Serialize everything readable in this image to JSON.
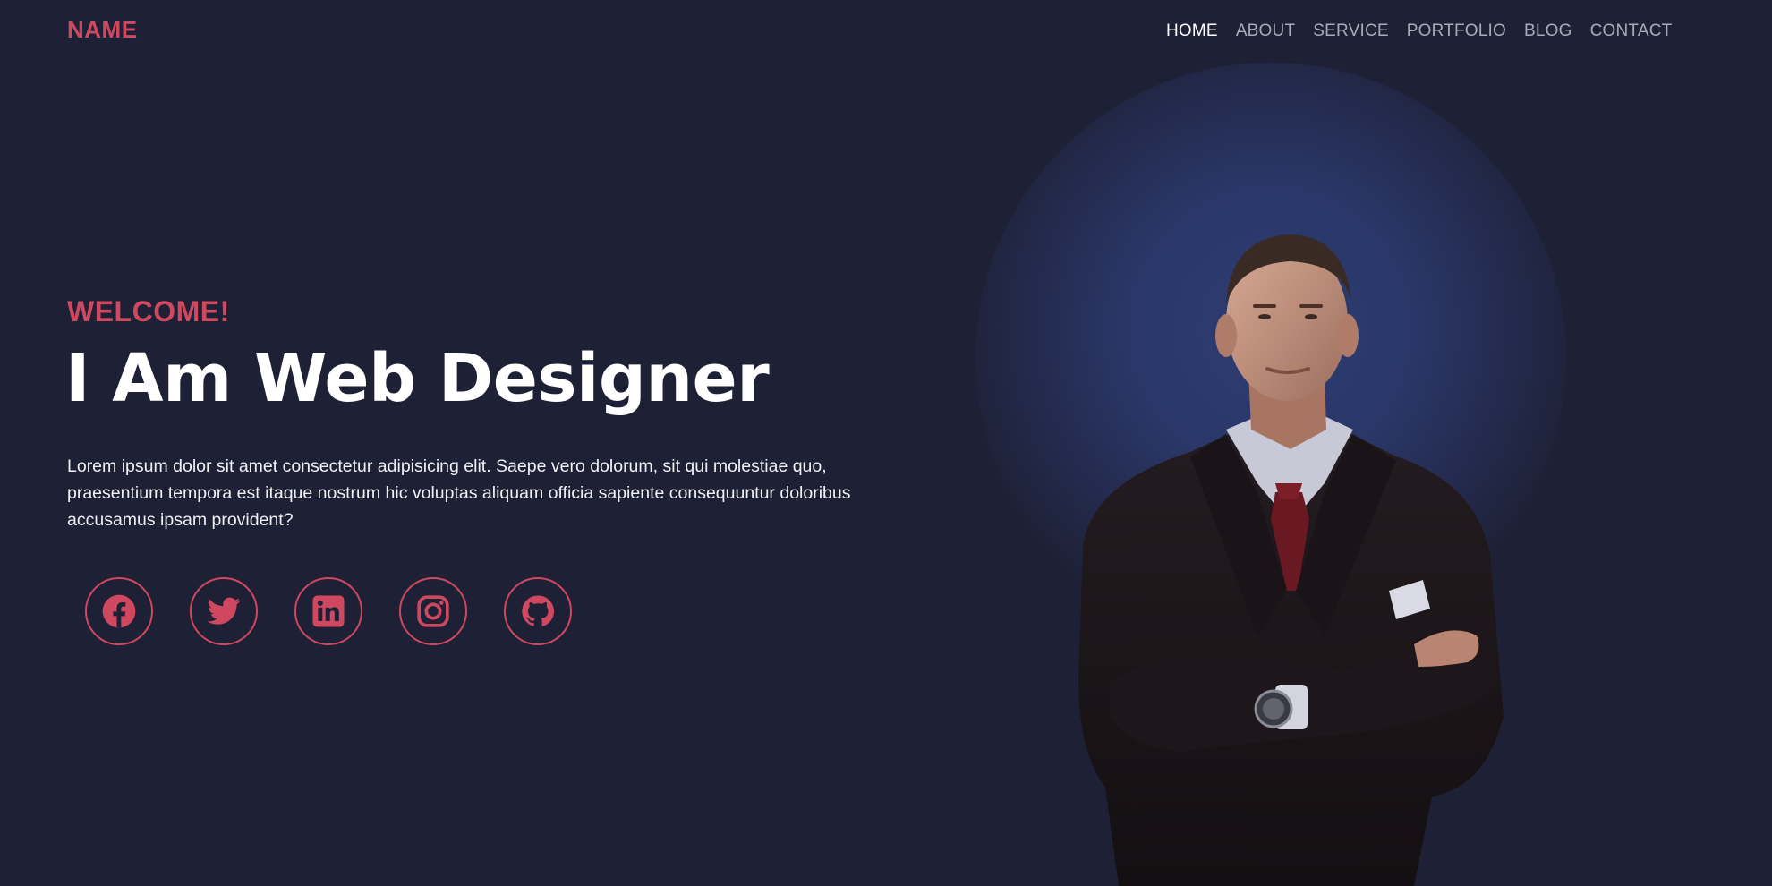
{
  "brand": {
    "name": "NAME"
  },
  "nav": {
    "items": [
      {
        "label": "HOME",
        "active": true
      },
      {
        "label": "ABOUT",
        "active": false
      },
      {
        "label": "SERVICE",
        "active": false
      },
      {
        "label": "PORTFOLIO",
        "active": false
      },
      {
        "label": "BLOG",
        "active": false
      },
      {
        "label": "CONTACT",
        "active": false
      }
    ]
  },
  "hero": {
    "welcome": "WELCOME!",
    "headline": "I Am Web Designer",
    "intro": "Lorem ipsum dolor sit amet consectetur adipisicing elit. Saepe vero dolorum, sit qui molestiae quo, praesentium tempora est itaque nostrum hic voluptas aliquam officia sapiente consequuntur doloribus accusamus ipsam provident?"
  },
  "socials": [
    {
      "icon": "facebook-icon"
    },
    {
      "icon": "twitter-icon"
    },
    {
      "icon": "linkedin-icon"
    },
    {
      "icon": "instagram-icon"
    },
    {
      "icon": "github-icon"
    }
  ],
  "colors": {
    "background": "#1e2136",
    "accent": "#d0485f",
    "nav_text": "#a8abbb",
    "glow": "#2d3c73"
  }
}
